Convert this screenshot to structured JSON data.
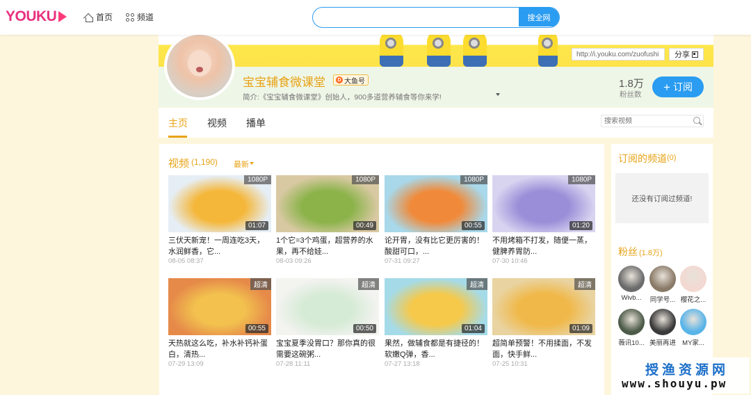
{
  "nav": {
    "logo": "YOUKU",
    "home": "首页",
    "channels": "频道",
    "search_value": "",
    "search_btn": "搜全网"
  },
  "banner": {
    "url": "http://i.youku.com/zuofushi",
    "share": "分享"
  },
  "profile": {
    "name": "宝宝辅食微课堂",
    "badge": "大鱼号",
    "intro": "简介:《宝宝辅食微课堂》创始人，900多道营养辅食等你来学!",
    "fans_num": "1.8万",
    "fans_label": "粉丝数",
    "subscribe": "订阅"
  },
  "tabs": {
    "home": "主页",
    "video": "视频",
    "playlist": "播单",
    "search_placeholder": "搜索视频"
  },
  "videos_section": {
    "title": "视频",
    "count": "(1,190)",
    "sort": "最新"
  },
  "videos": [
    {
      "title": "三伏天新宠！一周连吃3天，水润鲜香，它...",
      "date": "08-05 08:37",
      "quality": "1080P",
      "duration": "01:07",
      "colors": [
        "#f5b73a",
        "#e6eef5"
      ]
    },
    {
      "title": "1个它=3个鸡蛋，超营养的水果，再不给娃...",
      "date": "08-03 09:26",
      "quality": "1080P",
      "duration": "00:49",
      "colors": [
        "#8bb34a",
        "#d9c9a3"
      ]
    },
    {
      "title": "论开胃，没有比它更厉害的！酸甜可口，...",
      "date": "07-31 09:27",
      "quality": "1080P",
      "duration": "00:55",
      "colors": [
        "#f08a3a",
        "#a8d8ea"
      ]
    },
    {
      "title": "不用烤箱不打发，随便一蒸，健脾养胃防...",
      "date": "07-30 10:46",
      "quality": "1080P",
      "duration": "01:20",
      "colors": [
        "#9a8ed8",
        "#d8d4f0"
      ]
    },
    {
      "title": "天热就这么吃，补水补钙补蛋白，清热...",
      "date": "07-29 13:09",
      "quality": "超清",
      "duration": "00:55",
      "colors": [
        "#f2c14e",
        "#e68a4a"
      ]
    },
    {
      "title": "宝宝夏季没胃口？那你真的很需要这碗粥...",
      "date": "07-28 11:11",
      "quality": "超清",
      "duration": "00:50",
      "colors": [
        "#d6ebd6",
        "#f3f3f0"
      ]
    },
    {
      "title": "果然，做辅食都是有捷径的！软嫩Q弹，香...",
      "date": "07-27 13:18",
      "quality": "超清",
      "duration": "01:04",
      "colors": [
        "#f6c94a",
        "#a5dbe8"
      ]
    },
    {
      "title": "超简单预警！不用揉面，不发面，快手鲜...",
      "date": "07-25 10:31",
      "quality": "超清",
      "duration": "01:09",
      "colors": [
        "#f0b848",
        "#e9d3a0"
      ]
    }
  ],
  "sidebar": {
    "subs_title": "订阅的频道",
    "subs_count": "(0)",
    "subs_empty": "还没有订阅过频道!",
    "fans_title": "粉丝",
    "fans_count": "(1.8万)",
    "fans": [
      {
        "name": "Wivb...",
        "color": "#6b6b6b"
      },
      {
        "name": "同学号...",
        "color": "#8a7a68"
      },
      {
        "name": "樱花之...",
        "color": "#f3d9d2"
      },
      {
        "name": "薇讯10...",
        "color": "#4c5a48"
      },
      {
        "name": "美丽再进",
        "color": "#3a3a3a"
      },
      {
        "name": "MY家...",
        "color": "#59b4e8"
      }
    ]
  },
  "watermark": {
    "cn": "授渔资源网",
    "en": "www.shouyu.pw"
  }
}
